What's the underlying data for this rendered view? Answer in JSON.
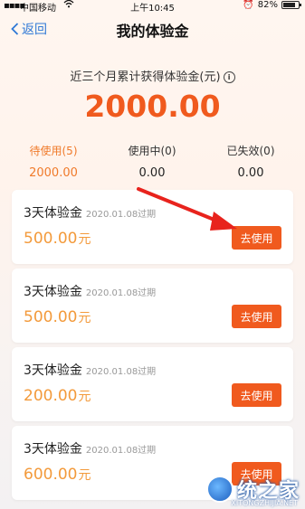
{
  "status_bar": {
    "carrier": "中国移动",
    "time": "上午10:45",
    "battery": "82%",
    "battery_level": 0.82
  },
  "nav": {
    "back_label": "返回",
    "title": "我的体验金"
  },
  "summary": {
    "label": "近三个月累计获得体验金(元)",
    "total": "2000.00"
  },
  "stats": [
    {
      "label": "待使用(5)",
      "value": "2000.00"
    },
    {
      "label": "使用中(0)",
      "value": "0.00"
    },
    {
      "label": "已失效(0)",
      "value": "0.00"
    }
  ],
  "cards": [
    {
      "title": "3天体验金",
      "expiry": "2020.01.08过期",
      "amount": "500.00",
      "unit": "元",
      "button": "去使用"
    },
    {
      "title": "3天体验金",
      "expiry": "2020.01.08过期",
      "amount": "500.00",
      "unit": "元",
      "button": "去使用"
    },
    {
      "title": "3天体验金",
      "expiry": "2020.01.08过期",
      "amount": "200.00",
      "unit": "元",
      "button": "去使用"
    },
    {
      "title": "3天体验金",
      "expiry": "2020.01.08过期",
      "amount": "600.00",
      "unit": "元",
      "button": "去使用"
    }
  ],
  "watermark": {
    "text": "统之家",
    "sub": "XITONGZHIJIA.NET"
  },
  "colors": {
    "accent": "#f05a1e",
    "amount": "#f39a3b",
    "link": "#2f79d6",
    "active_stat": "#f07a2a"
  },
  "icons": [
    "signal-icon",
    "wifi-icon",
    "alarm-icon",
    "battery-icon",
    "back-chevron-icon",
    "info-icon",
    "red-arrow-icon",
    "watermark-logo-icon"
  ]
}
